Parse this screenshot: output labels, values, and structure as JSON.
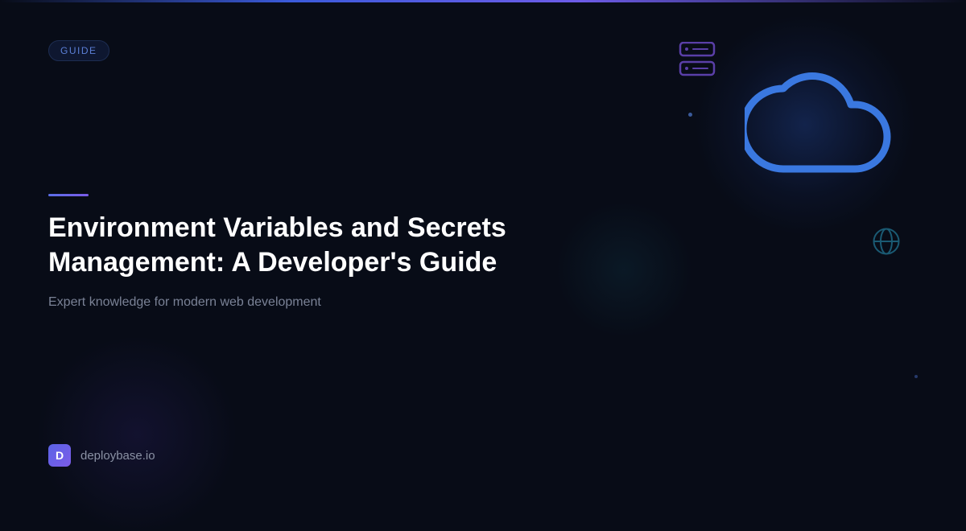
{
  "badge": {
    "label": "GUIDE"
  },
  "article": {
    "title": "Environment Variables and Secrets Management: A Developer's Guide",
    "subtitle": "Expert knowledge for modern web development"
  },
  "brand": {
    "logo_letter": "D",
    "site": "deploybase.io"
  },
  "colors": {
    "background": "#080c17",
    "accent": "#5b6ee8",
    "cloud_icon": "#3a78e0",
    "server_icon": "#5a3fa8",
    "globe_icon": "#1a5a73"
  },
  "icons": [
    "server-icon",
    "cloud-icon",
    "globe-icon"
  ]
}
